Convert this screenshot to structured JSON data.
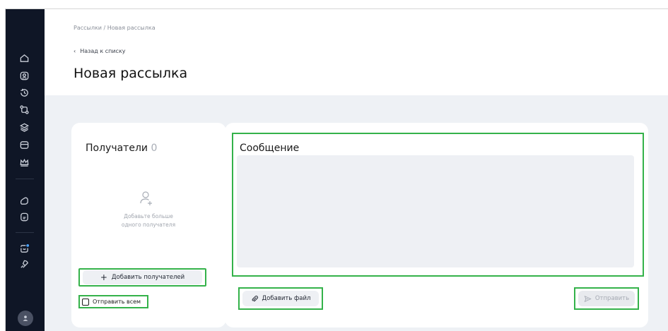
{
  "breadcrumb": "Рассылки / Новая рассылка",
  "back_link": "Назад к списку",
  "page_title": "Новая рассылка",
  "sidebar": {
    "icons": [
      "home-icon",
      "contacts-icon",
      "history-icon",
      "workflow-icon",
      "database-icon",
      "storage-icon",
      "crown-icon",
      "folder-icon",
      "document-icon",
      "chat-icon",
      "tag-icon"
    ],
    "notification_color": "#4aa3ff"
  },
  "recipients": {
    "title": "Получатели",
    "count": "0",
    "empty_line1": "Добавьте больше",
    "empty_line2": "одного получателя",
    "add_button": "Добавить получателей",
    "send_all_label": "Отправить всем"
  },
  "message": {
    "title": "Сообщение",
    "attach_button": "Добавить файл",
    "send_button": "Отправить"
  },
  "colors": {
    "highlight": "#34b24a",
    "sidebar_bg": "#0f1626"
  }
}
